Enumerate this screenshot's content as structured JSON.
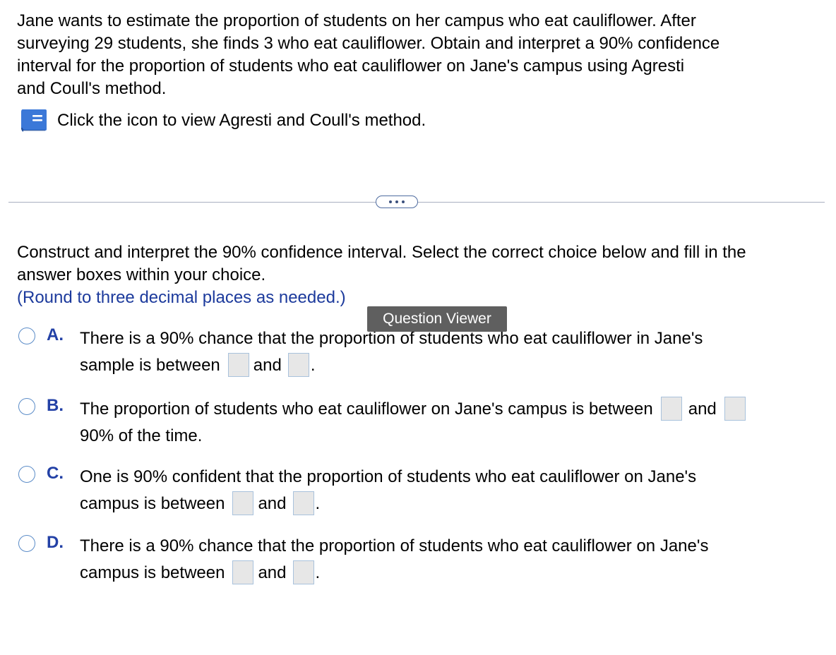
{
  "question": {
    "text": "Jane wants to estimate the proportion of students on her campus who eat cauliflower. After surveying 29 students, she finds 3 who eat cauliflower. Obtain and interpret a 90% confidence interval for the proportion of students who eat cauliflower on Jane's campus using Agresti and Coull's method.",
    "line1": "Jane wants to estimate the proportion of students on her campus who eat cauliflower. After",
    "line2": "surveying 29 students, she finds 3 who eat cauliflower. Obtain and interpret a 90% confidence",
    "line3": "interval for the proportion of students who eat cauliflower on Jane's campus using Agresti",
    "line4": "and Coull's method."
  },
  "hint": {
    "icon": "book-icon",
    "text": "Click the icon to view Agresti and Coull's method."
  },
  "divider": {
    "expand_label": "..."
  },
  "instructions": {
    "line1": "Construct and interpret the 90% confidence interval. Select the correct choice below and fill in the",
    "line2": "answer boxes within your choice.",
    "rounding": "(Round to three decimal places as needed.)"
  },
  "tooltip": {
    "text": "Question Viewer"
  },
  "choices": [
    {
      "letter": "A.",
      "line1": "There is a 90% chance that the proportion of students who eat cauliflower in Jane's",
      "line2_pre": "sample is between",
      "and": "and",
      "end": ".",
      "box1_value": "",
      "box2_value": ""
    },
    {
      "letter": "B.",
      "line1_pre": "The proportion of students who eat cauliflower on Jane's campus is between",
      "and": "and",
      "line2": "90% of the time.",
      "box1_value": "",
      "box2_value": ""
    },
    {
      "letter": "C.",
      "line1": "One is 90% confident that the proportion of students who eat cauliflower on Jane's",
      "line2_pre": "campus is between",
      "and": "and",
      "end": ".",
      "box1_value": "",
      "box2_value": ""
    },
    {
      "letter": "D.",
      "line1": "There is a 90% chance that the proportion of students who eat cauliflower on Jane's",
      "line2_pre": "campus is between",
      "and": "and",
      "end": ".",
      "box1_value": "",
      "box2_value": ""
    }
  ],
  "colors": {
    "accent": "#2341a6",
    "radio_border": "#5b8cc8",
    "tooltip_bg": "#5f5f5f",
    "book_icon": "#3b78d8"
  }
}
